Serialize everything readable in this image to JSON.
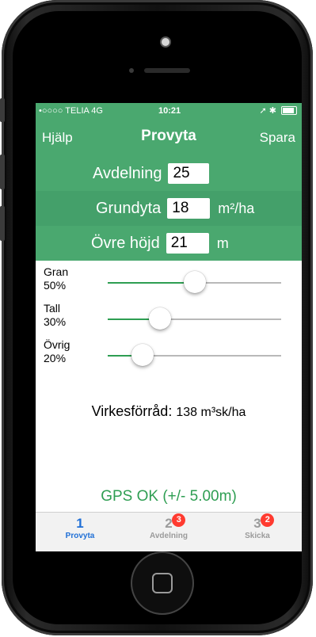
{
  "status": {
    "carrier": "•○○○○ TELIA 4G",
    "time": "10:21",
    "right_icons": "➚ ✱"
  },
  "navbar": {
    "left": "Hjälp",
    "title": "Provyta",
    "right": "Spara"
  },
  "fields": {
    "avdelning": {
      "label": "Avdelning",
      "value": "25"
    },
    "grundyta": {
      "label": "Grundyta",
      "value": "18",
      "unit": "m²/ha"
    },
    "ovre_hojd": {
      "label": "Övre höjd",
      "value": "21",
      "unit": "m"
    }
  },
  "sliders": [
    {
      "name": "Gran",
      "percent_text": "50%",
      "value": 0.5
    },
    {
      "name": "Tall",
      "percent_text": "30%",
      "value": 0.3
    },
    {
      "name": "Övrig",
      "percent_text": "20%",
      "value": 0.2
    }
  ],
  "virkes": {
    "label": "Virkesförråd:",
    "value": "138 m³sk/ha"
  },
  "gps": "GPS OK (+/- 5.00m)",
  "tabs": [
    {
      "num": "1",
      "label": "Provyta",
      "badge": ""
    },
    {
      "num": "2",
      "label": "Avdelning",
      "badge": "3"
    },
    {
      "num": "3",
      "label": "Skicka",
      "badge": "2"
    }
  ],
  "colors": {
    "accent": "#4aa86f",
    "tab_active": "#1f6fd6",
    "badge": "#ff3b30"
  }
}
